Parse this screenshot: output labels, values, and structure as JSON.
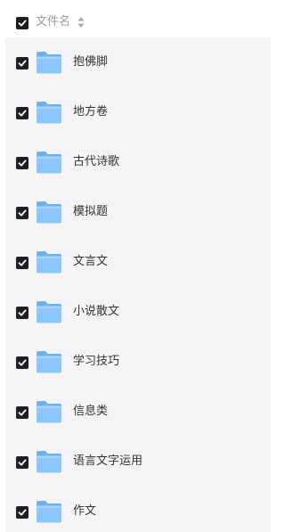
{
  "header": {
    "column_label": "文件名",
    "all_selected": true,
    "sort_icon": "sort-updown-icon"
  },
  "files": [
    {
      "name": "抱佛脚",
      "selected": true,
      "icon": "folder-icon"
    },
    {
      "name": "地方卷",
      "selected": true,
      "icon": "folder-icon"
    },
    {
      "name": "古代诗歌",
      "selected": true,
      "icon": "folder-icon"
    },
    {
      "name": "模拟题",
      "selected": true,
      "icon": "folder-icon"
    },
    {
      "name": "文言文",
      "selected": true,
      "icon": "folder-icon"
    },
    {
      "name": "小说散文",
      "selected": true,
      "icon": "folder-icon"
    },
    {
      "name": "学习技巧",
      "selected": true,
      "icon": "folder-icon"
    },
    {
      "name": "信息类",
      "selected": true,
      "icon": "folder-icon"
    },
    {
      "name": "语言文字运用",
      "selected": true,
      "icon": "folder-icon"
    },
    {
      "name": "作文",
      "selected": true,
      "icon": "folder-icon"
    }
  ],
  "colors": {
    "checkbox": "#1f1f23",
    "list_background": "#f4f4f6",
    "folder_front": "#8ec5fb",
    "folder_back": "#6fb0f5",
    "header_text": "#999999",
    "row_text": "#333333"
  }
}
